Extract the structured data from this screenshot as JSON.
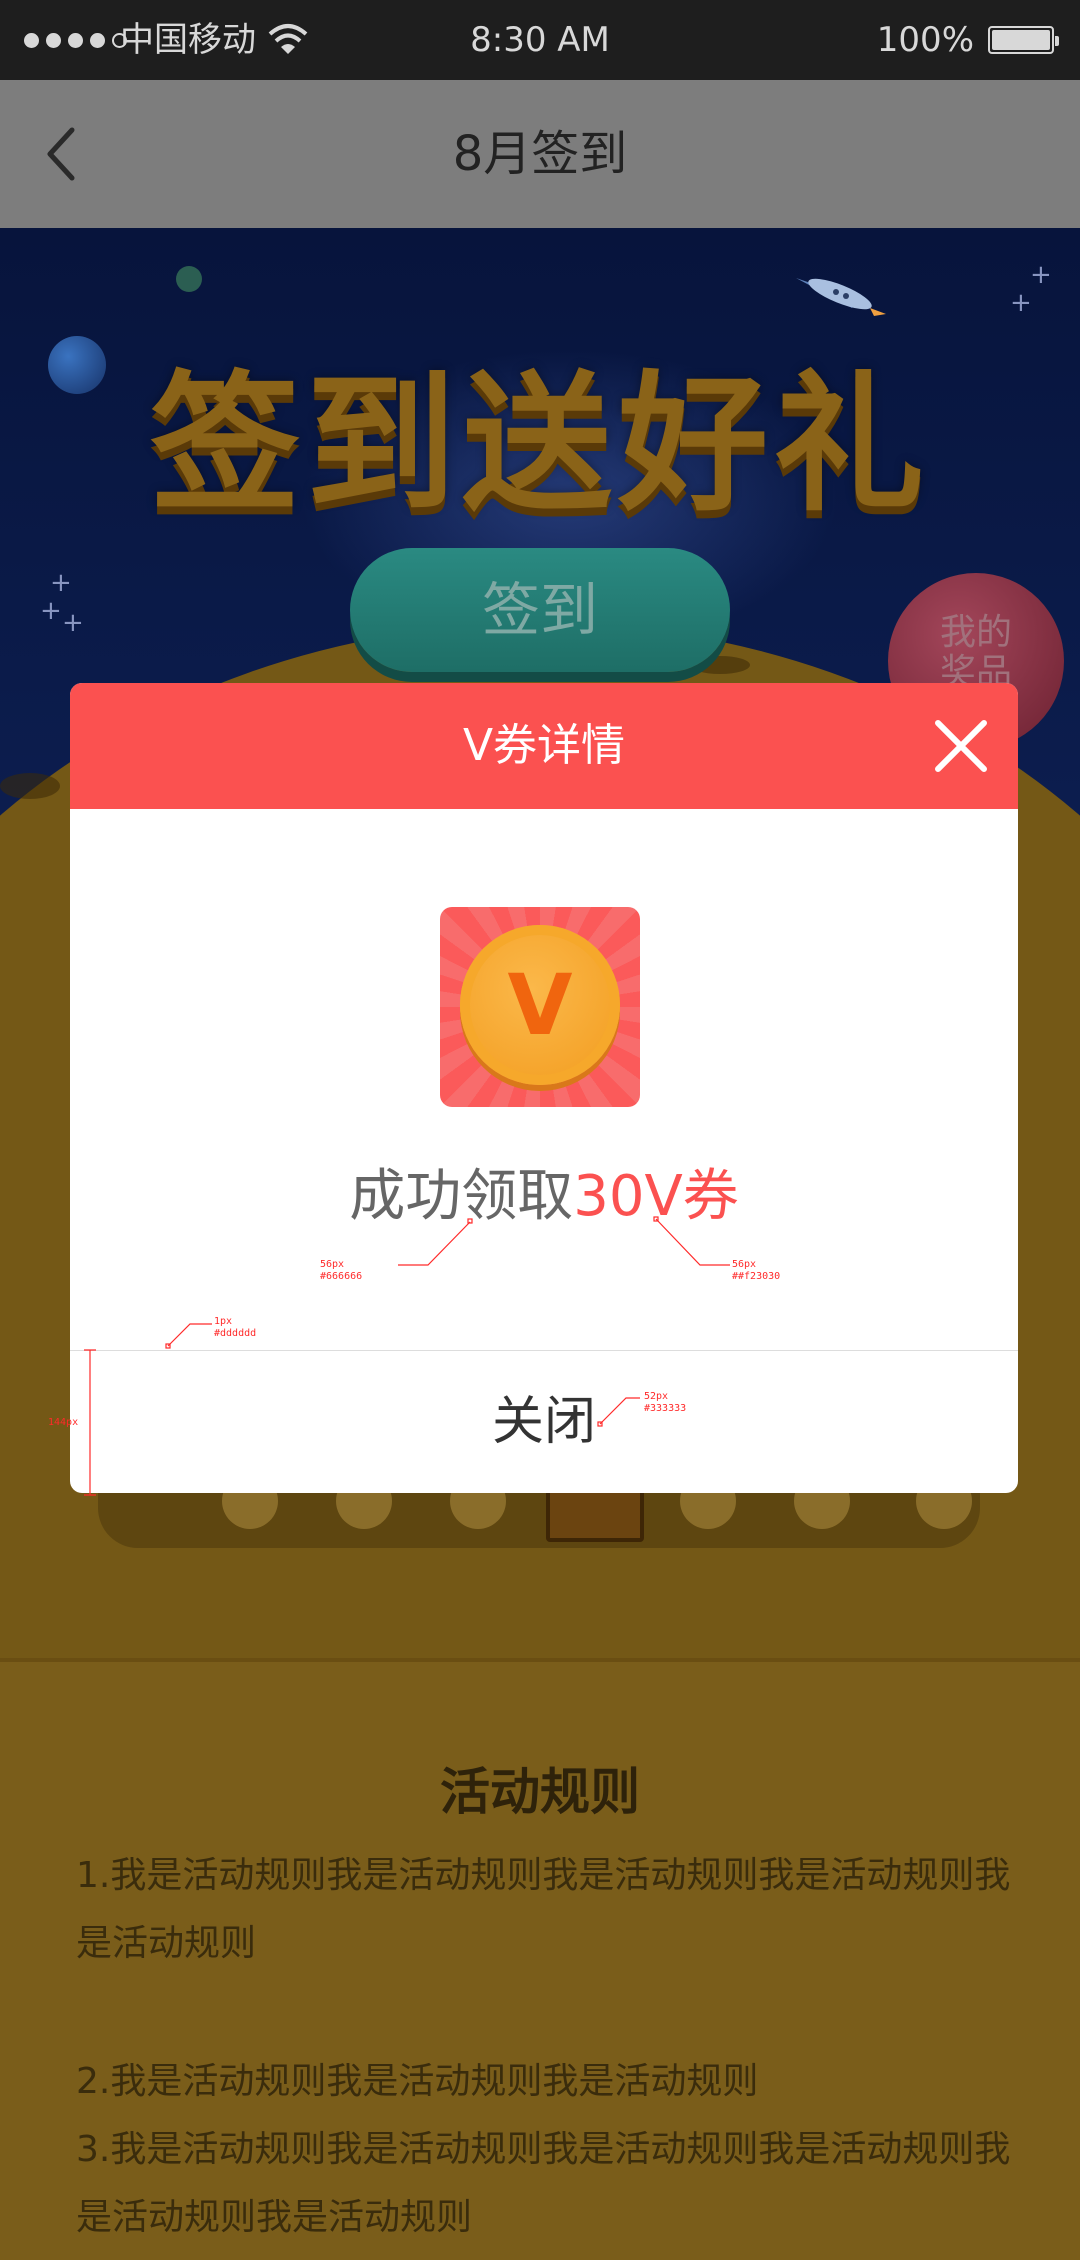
{
  "status_bar": {
    "carrier": "中国移动",
    "time": "8:30 AM",
    "battery": "100%"
  },
  "nav": {
    "title": "8月签到"
  },
  "hero": {
    "banner_title": "签到送好礼",
    "signin_button": "签到",
    "my_prize_line1": "我的",
    "my_prize_line2": "奖品"
  },
  "modal": {
    "title": "V券详情",
    "coin_letter": "V",
    "success_prefix": "成功领取",
    "success_amount": "30V券",
    "close_label": "关闭"
  },
  "annotations": {
    "a1_size": "56px",
    "a1_color": "#666666",
    "a2_size": "56px",
    "a2_color": "##f23030",
    "a3_size": "1px",
    "a3_color": "#dddddd",
    "a4_size": "144px",
    "a5_size": "52px",
    "a5_color": "#333333"
  },
  "rules": {
    "title": "活动规则",
    "items": [
      "1.我是活动规则我是活动规则我是活动规则我是活动规则我是活动规则",
      "2.我是活动规则我是活动规则我是活动规则",
      "3.我是活动规则我是活动规则我是活动规则我是活动规则我是活动规则我是活动规则"
    ]
  }
}
